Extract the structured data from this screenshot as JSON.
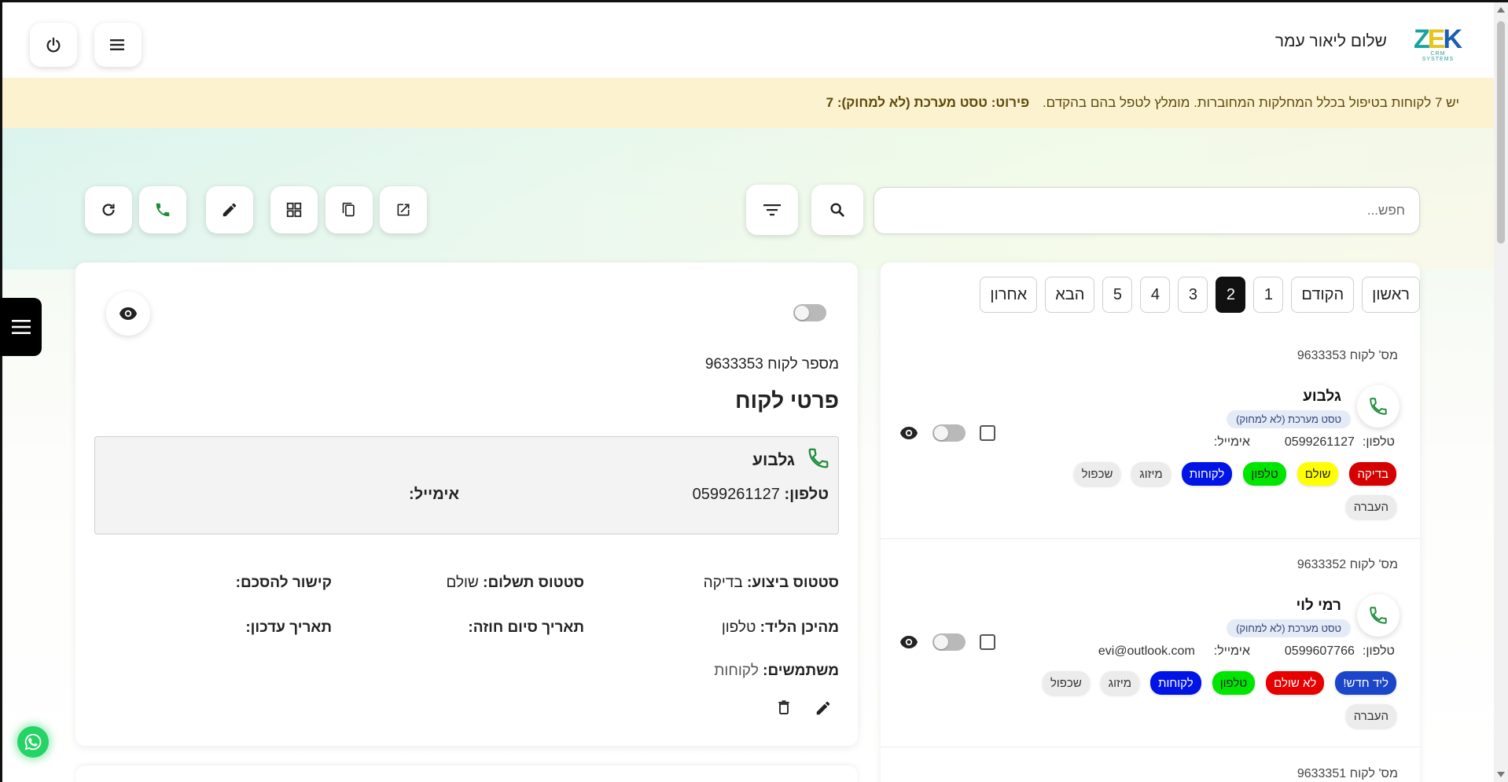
{
  "header": {
    "logo_text_z": "Z",
    "logo_text_e": "E",
    "logo_text_k": "K",
    "logo_sub": "CRM SYSTEMS",
    "greeting": "שלום ליאור עמר"
  },
  "banner": {
    "message": "יש 7 לקוחות בטיפול בכלל המחלקות המחוברות. מומלץ לטפל בהם בהקדם.",
    "detail": "פירוט: טסט מערכת (לא למחוק): 7"
  },
  "search": {
    "placeholder": "חפש..."
  },
  "pagination": {
    "first": "ראשון",
    "prev": "הקודם",
    "pages": [
      "1",
      "2",
      "3",
      "4",
      "5"
    ],
    "active_page": "2",
    "next": "הבא",
    "last": "אחרון"
  },
  "customers": [
    {
      "number_label": "מס' לקוח 9633353",
      "name": "גלבוע",
      "department": "טסט מערכת (לא למחוק)",
      "phone_label": "טלפון:",
      "phone": "0599261127",
      "email_label": "אימייל:",
      "email": "",
      "tags": [
        {
          "label": "בדיקה",
          "bg": "#d50000",
          "fg": "#ffffff"
        },
        {
          "label": "שולם",
          "bg": "#ffff00",
          "fg": "#222222"
        },
        {
          "label": "טלפון",
          "bg": "#00e600",
          "fg": "#222222"
        },
        {
          "label": "לקוחות",
          "bg": "#0014e6",
          "fg": "#ffffff"
        }
      ],
      "grey_tags": [
        "מיזוג",
        "שכפול"
      ],
      "transfer": "העברה"
    },
    {
      "number_label": "מס' לקוח 9633352",
      "name": "רמי לוי",
      "department": "טסט מערכת (לא למחוק)",
      "phone_label": "טלפון:",
      "phone": "0599607766",
      "email_label": "אימייל:",
      "email": "evi@outlook.com",
      "tags": [
        {
          "label": "ליד חדש!",
          "bg": "#1c46c9",
          "fg": "#ffffff"
        },
        {
          "label": "לא שולם",
          "bg": "#e60000",
          "fg": "#ffffff"
        },
        {
          "label": "טלפון",
          "bg": "#00e600",
          "fg": "#222222"
        },
        {
          "label": "לקוחות",
          "bg": "#0014e6",
          "fg": "#ffffff"
        }
      ],
      "grey_tags": [
        "מיזוג",
        "שכפול"
      ],
      "transfer": "העברה"
    },
    {
      "number_label": "מס' לקוח 9633351"
    }
  ],
  "detail": {
    "customer_number": "מספר לקוח 9633353",
    "title": "פרטי לקוח",
    "name": "גלבוע",
    "phone_label": "טלפון:",
    "phone": "0599261127",
    "email_label": "אימייל:",
    "exec_status_label": "סטטוס ביצוע:",
    "exec_status": "בדיקה",
    "pay_status_label": "סטטוס תשלום:",
    "pay_status": "שולם",
    "agreement_label": "קישור להסכם:",
    "lead_source_label": "מהיכן הליד:",
    "lead_source": "טלפון",
    "contract_end_label": "תאריך סיום חוזה:",
    "update_date_label": "תאריך עדכון:",
    "users_label": "משתמשים:",
    "users": "לקוחות"
  },
  "colors": {
    "banner_bg": "#fcf2cf",
    "phone_green": "#1e8c3a",
    "active_page_bg": "#111111",
    "whatsapp": "#25d366"
  }
}
